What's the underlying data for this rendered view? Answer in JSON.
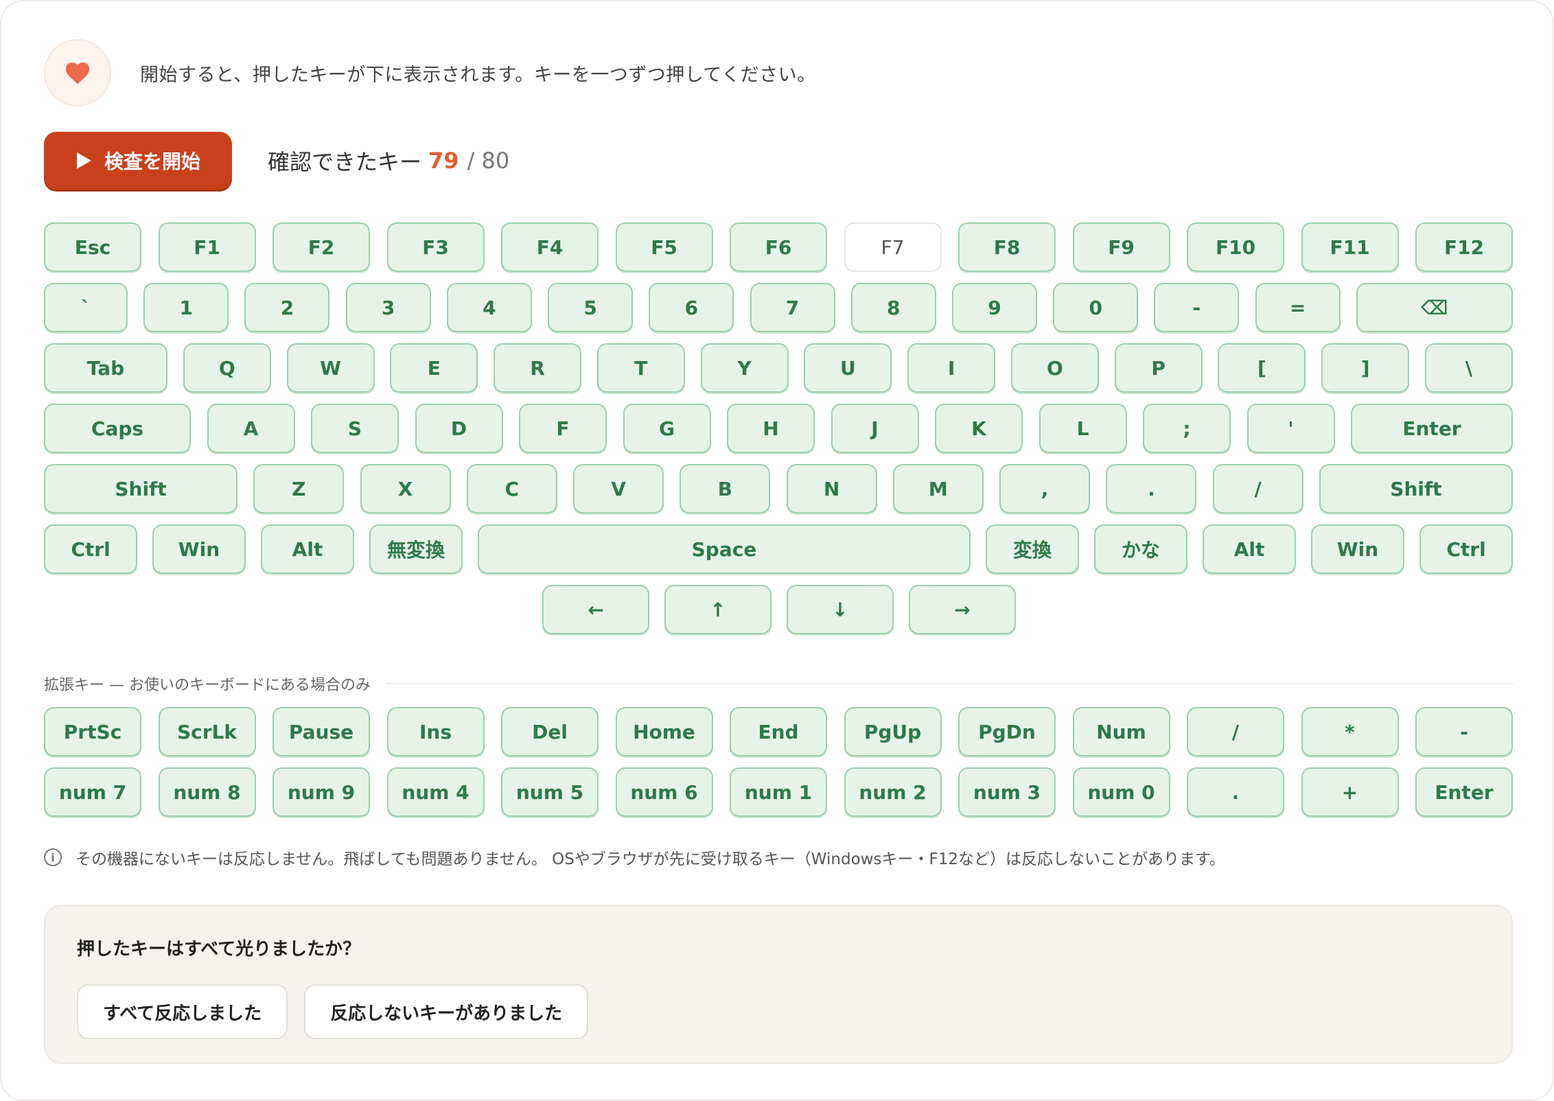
{
  "intro_text": "開始すると、押したキーが下に表示されます。キーを一つずつ押してください。",
  "start_label": "検査を開始",
  "counter": {
    "label": "確認できたキー",
    "confirmed": "79",
    "total": "/ 80"
  },
  "rows": [
    [
      {
        "label": "Esc",
        "w": 142
      },
      {
        "label": "F1",
        "w": 142
      },
      {
        "label": "F2",
        "w": 142
      },
      {
        "label": "F3",
        "w": 142
      },
      {
        "label": "F4",
        "w": 142
      },
      {
        "label": "F5",
        "w": 142
      },
      {
        "label": "F6",
        "w": 142
      },
      {
        "label": "F7",
        "w": 142,
        "off": true
      },
      {
        "label": "F8",
        "w": 142
      },
      {
        "label": "F9",
        "w": 142
      },
      {
        "label": "F10",
        "w": 142
      },
      {
        "label": "F11",
        "w": 142
      },
      {
        "label": "F12",
        "w": 142
      }
    ],
    [
      {
        "label": "`",
        "w": 122
      },
      {
        "label": "1",
        "w": 124
      },
      {
        "label": "2",
        "w": 124
      },
      {
        "label": "3",
        "w": 124
      },
      {
        "label": "4",
        "w": 124
      },
      {
        "label": "5",
        "w": 124
      },
      {
        "label": "6",
        "w": 124
      },
      {
        "label": "7",
        "w": 124
      },
      {
        "label": "8",
        "w": 124
      },
      {
        "label": "9",
        "w": 124
      },
      {
        "label": "0",
        "w": 124
      },
      {
        "label": "-",
        "w": 124
      },
      {
        "label": "=",
        "w": 124
      },
      {
        "label": "⌫",
        "w": 228
      }
    ],
    [
      {
        "label": "Tab",
        "w": 180
      },
      {
        "label": "Q",
        "w": 128
      },
      {
        "label": "W",
        "w": 128
      },
      {
        "label": "E",
        "w": 128
      },
      {
        "label": "R",
        "w": 128
      },
      {
        "label": "T",
        "w": 128
      },
      {
        "label": "Y",
        "w": 128
      },
      {
        "label": "U",
        "w": 128
      },
      {
        "label": "I",
        "w": 128
      },
      {
        "label": "O",
        "w": 128
      },
      {
        "label": "P",
        "w": 128
      },
      {
        "label": "[",
        "w": 128
      },
      {
        "label": "]",
        "w": 128
      },
      {
        "label": "\\",
        "w": 128
      }
    ],
    [
      {
        "label": "Caps",
        "w": 214
      },
      {
        "label": "A",
        "w": 128
      },
      {
        "label": "S",
        "w": 128
      },
      {
        "label": "D",
        "w": 128
      },
      {
        "label": "F",
        "w": 128
      },
      {
        "label": "G",
        "w": 128
      },
      {
        "label": "H",
        "w": 128
      },
      {
        "label": "J",
        "w": 128
      },
      {
        "label": "K",
        "w": 128
      },
      {
        "label": "L",
        "w": 128
      },
      {
        "label": ";",
        "w": 128
      },
      {
        "label": "'",
        "w": 128
      },
      {
        "label": "Enter",
        "w": 236
      }
    ],
    [
      {
        "label": "Shift",
        "w": 282
      },
      {
        "label": "Z",
        "w": 132
      },
      {
        "label": "X",
        "w": 132
      },
      {
        "label": "C",
        "w": 132
      },
      {
        "label": "V",
        "w": 132
      },
      {
        "label": "B",
        "w": 132
      },
      {
        "label": "N",
        "w": 132
      },
      {
        "label": "M",
        "w": 132
      },
      {
        "label": ",",
        "w": 132
      },
      {
        "label": ".",
        "w": 132
      },
      {
        "label": "/",
        "w": 132
      },
      {
        "label": "Shift",
        "w": 282
      }
    ],
    [
      {
        "label": "Ctrl",
        "w": 136
      },
      {
        "label": "Win",
        "w": 136
      },
      {
        "label": "Alt",
        "w": 136
      },
      {
        "label": "無変換",
        "w": 136
      },
      {
        "label": "Space",
        "w": 718
      },
      {
        "label": "変換",
        "w": 136
      },
      {
        "label": "かな",
        "w": 136
      },
      {
        "label": "Alt",
        "w": 136
      },
      {
        "label": "Win",
        "w": 136
      },
      {
        "label": "Ctrl",
        "w": 136
      }
    ]
  ],
  "arrows": [
    "←",
    "↑",
    "↓",
    "→"
  ],
  "ext_label": "拡張キー — お使いのキーボードにある場合のみ",
  "ext_rows": [
    [
      "PrtSc",
      "ScrLk",
      "Pause",
      "Ins",
      "Del",
      "Home",
      "End",
      "PgUp",
      "PgDn",
      "Num",
      "/",
      "*",
      "-"
    ],
    [
      "num 7",
      "num 8",
      "num 9",
      "num 4",
      "num 5",
      "num 6",
      "num 1",
      "num 2",
      "num 3",
      "num 0",
      ".",
      "+",
      "Enter"
    ]
  ],
  "note": "その機器にないキーは反応しません。飛ばしても問題ありません。 OSやブラウザが先に受け取るキー（Windowsキー・F12など）は反応しないことがあります。",
  "confirm": {
    "question": "押したキーはすべて光りましたか？",
    "yes_label": "すべて反応しました",
    "no_label": "反応しないキーがありました"
  },
  "colors": {
    "accent": "#c8401c",
    "key_bg": "#e6f3e9",
    "key_border": "#9ccfac",
    "key_text": "#2f7a48"
  },
  "icons": [
    "heart-icon",
    "play-icon",
    "info-icon"
  ]
}
